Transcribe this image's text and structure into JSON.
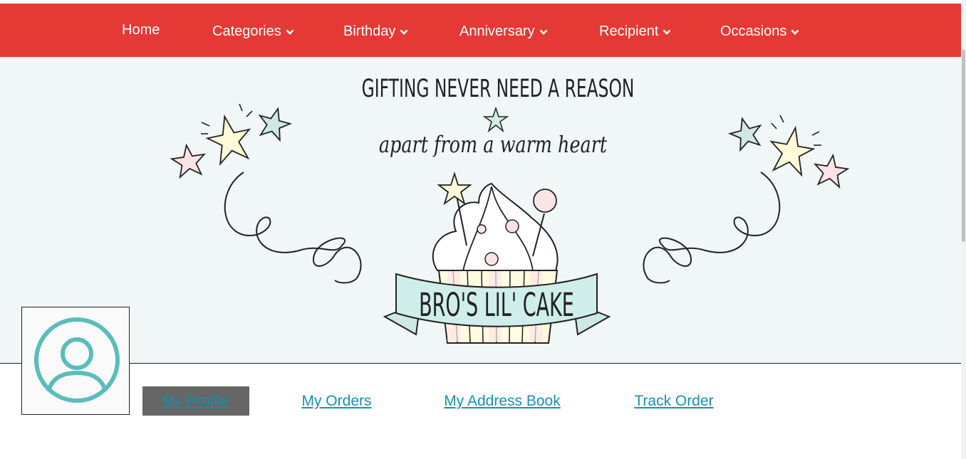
{
  "nav": {
    "items": [
      {
        "label": "Home",
        "has_dropdown": false
      },
      {
        "label": "Categories",
        "has_dropdown": true
      },
      {
        "label": "Birthday",
        "has_dropdown": true
      },
      {
        "label": "Anniversary",
        "has_dropdown": true
      },
      {
        "label": "Recipient",
        "has_dropdown": true
      },
      {
        "label": "Occasions",
        "has_dropdown": true
      }
    ]
  },
  "banner": {
    "tagline_top": "GIFTING NEVER NEED A REASON",
    "tagline_bottom": "apart from a warm heart",
    "brand": "BRO'S LIL' CAKE"
  },
  "account": {
    "tabs": [
      {
        "label": "My Profile",
        "active": true
      },
      {
        "label": "My Orders",
        "active": false
      },
      {
        "label": "My Address Book",
        "active": false
      },
      {
        "label": "Track Order",
        "active": false
      }
    ]
  },
  "colors": {
    "nav_bg": "#e53935",
    "banner_bg": "#f1f7f6",
    "avatar": "#5bbcbc",
    "link": "#1a8fb0"
  }
}
